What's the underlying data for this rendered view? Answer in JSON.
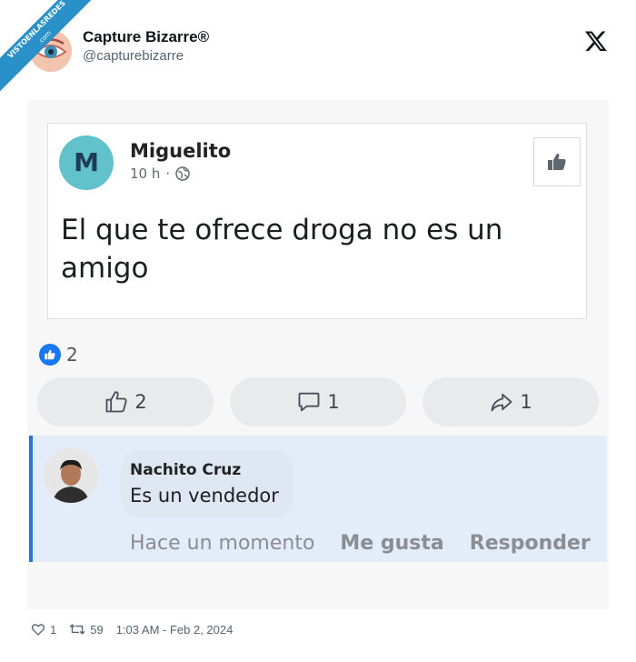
{
  "ribbon": {
    "line1": "VISTOENLASREDES",
    "line2": ".com"
  },
  "tweet": {
    "display_name": "Capture Bizarre®",
    "handle": "@capturebizarre",
    "likes": "1",
    "retweets": "59",
    "timestamp": "1:03 AM - Feb 2, 2024"
  },
  "post": {
    "avatar_letter": "M",
    "author": "Miguelito",
    "time": "10 h",
    "separator": "·",
    "text": "El que te ofrece droga no es un amigo",
    "reaction_count": "2"
  },
  "actions": {
    "like_count": "2",
    "comment_count": "1",
    "share_count": "1"
  },
  "comment": {
    "author": "Nachito Cruz",
    "text": "Es un vendedor",
    "time": "Hace un momento",
    "like_label": "Me gusta",
    "reply_label": "Responder"
  },
  "colors": {
    "facebook_blue": "#1877f2",
    "avatar_teal": "#62c2cc",
    "comment_highlight": "#e3edfa"
  }
}
